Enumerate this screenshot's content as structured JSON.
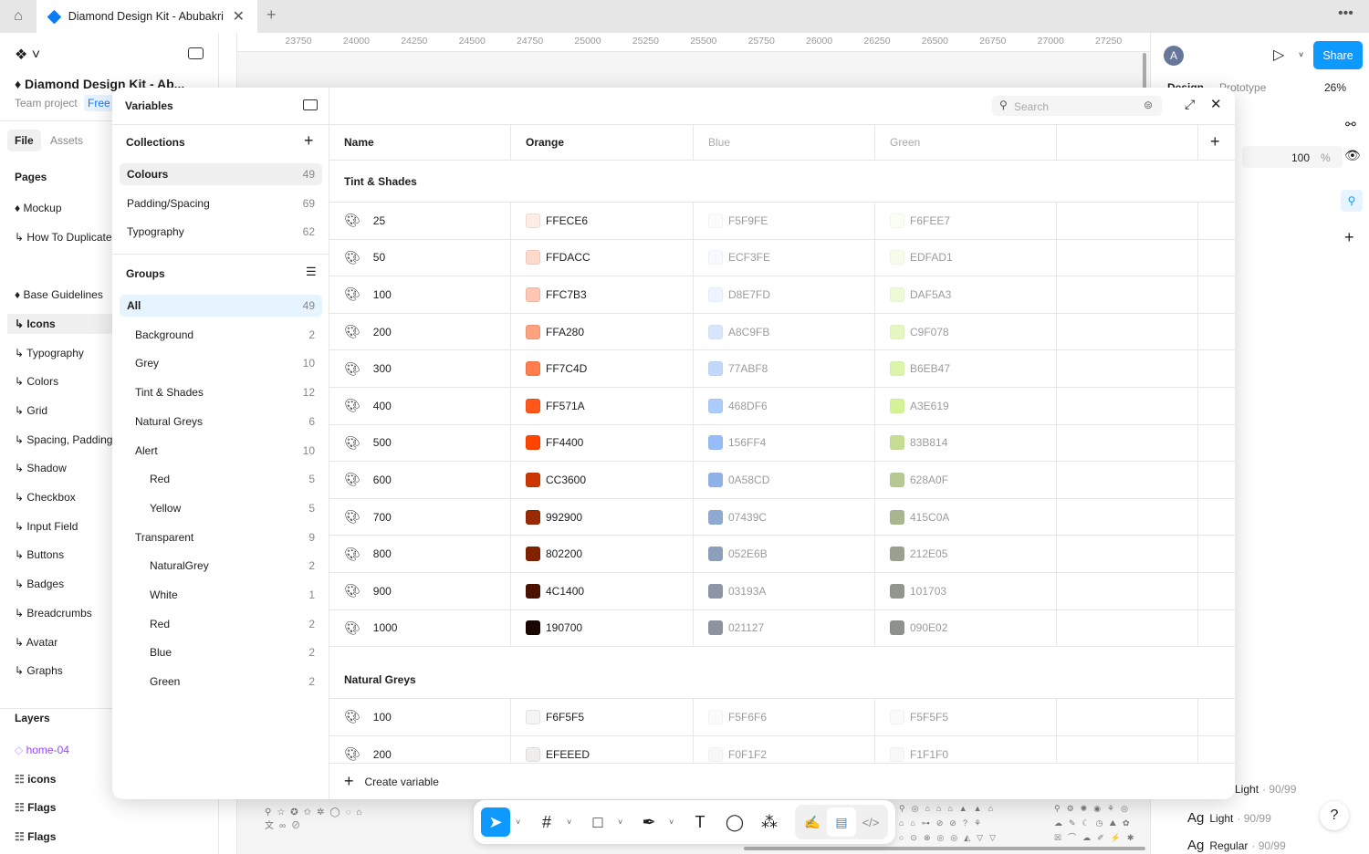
{
  "tabs": {
    "file_tab": "Diamond Design Kit - Abubakriqb"
  },
  "sidebar": {
    "file_name": "Diamond Design Kit - Ab...",
    "project": "Team project",
    "plan": "Free",
    "tab_file": "File",
    "tab_assets": "Assets",
    "pages_title": "Pages",
    "pages": [
      "Mockup",
      "How To Duplicate",
      "",
      "Base Guidelines",
      "Icons",
      "Typography",
      "Colors",
      "Grid",
      "Spacing, Padding",
      "Shadow",
      "Checkbox",
      "Input Field",
      "Buttons",
      "Badges",
      "Breadcrumbs",
      "Avatar",
      "Graphs"
    ],
    "layers_title": "Layers",
    "layers": [
      {
        "label": "home-04",
        "color": "#9747ff"
      },
      {
        "label": "icons"
      },
      {
        "label": "Flags"
      },
      {
        "label": "Flags"
      }
    ]
  },
  "ruler": [
    "23750",
    "24000",
    "24250",
    "24500",
    "24750",
    "25000",
    "25250",
    "25500",
    "25750",
    "26000",
    "26250",
    "26500",
    "26750",
    "27000",
    "27250"
  ],
  "right_panel": {
    "avatar": "A",
    "share": "Share",
    "tab_design": "Design",
    "tab_prototype": "Prototype",
    "zoom": "26%",
    "opacity": "100",
    "percent": "%",
    "type_samples": [
      {
        "ag": "",
        "label": "Light",
        "meta": "· 90/99"
      },
      {
        "ag": "Ag",
        "label": "Light",
        "meta": "· 90/99"
      },
      {
        "ag": "Ag",
        "label": "Regular",
        "meta": "· 90/99"
      }
    ],
    "help": "?"
  },
  "variables": {
    "title": "Variables",
    "collections_title": "Collections",
    "collections": [
      {
        "label": "Colours",
        "count": "49",
        "selected": true
      },
      {
        "label": "Padding/Spacing",
        "count": "69"
      },
      {
        "label": "Typography",
        "count": "62"
      }
    ],
    "groups_title": "Groups",
    "groups": [
      {
        "label": "All",
        "count": "49",
        "level": 0,
        "selected": true
      },
      {
        "label": "Background",
        "count": "2",
        "level": 1
      },
      {
        "label": "Grey",
        "count": "10",
        "level": 1
      },
      {
        "label": "Tint & Shades",
        "count": "12",
        "level": 1
      },
      {
        "label": "Natural Greys",
        "count": "6",
        "level": 1
      },
      {
        "label": "Alert",
        "count": "10",
        "level": 1
      },
      {
        "label": "Red",
        "count": "5",
        "level": 2
      },
      {
        "label": "Yellow",
        "count": "5",
        "level": 2
      },
      {
        "label": "Transparent",
        "count": "9",
        "level": 1
      },
      {
        "label": "NaturalGrey",
        "count": "2",
        "level": 2
      },
      {
        "label": "White",
        "count": "1",
        "level": 2
      },
      {
        "label": "Red",
        "count": "2",
        "level": 2
      },
      {
        "label": "Blue",
        "count": "2",
        "level": 2
      },
      {
        "label": "Green",
        "count": "2",
        "level": 2
      }
    ],
    "search_placeholder": "Search",
    "columns": [
      "Name",
      "Orange",
      "Blue",
      "Green"
    ],
    "sections": [
      {
        "title": "Tint & Shades",
        "rows": [
          [
            "25",
            "FFECE6",
            "F5F9FE",
            "F6FEE7"
          ],
          [
            "50",
            "FFDACC",
            "ECF3FE",
            "EDFAD1"
          ],
          [
            "100",
            "FFC7B3",
            "D8E7FD",
            "DAF5A3"
          ],
          [
            "200",
            "FFA280",
            "A8C9FB",
            "C9F078"
          ],
          [
            "300",
            "FF7C4D",
            "77ABF8",
            "B6EB47"
          ],
          [
            "400",
            "FF571A",
            "468DF6",
            "A3E619"
          ],
          [
            "500",
            "FF4400",
            "156FF4",
            "83B814"
          ],
          [
            "600",
            "CC3600",
            "0A58CD",
            "628A0F"
          ],
          [
            "700",
            "992900",
            "07439C",
            "415C0A"
          ],
          [
            "800",
            "802200",
            "052E6B",
            "212E05"
          ],
          [
            "900",
            "4C1400",
            "03193A",
            "101703"
          ],
          [
            "1000",
            "190700",
            "021127",
            "090E02"
          ]
        ]
      },
      {
        "title": "Natural Greys",
        "rows": [
          [
            "100",
            "F6F5F5",
            "F5F6F6",
            "F5F5F5"
          ],
          [
            "200",
            "EFEEED",
            "F0F1F2",
            "F1F1F0"
          ]
        ]
      }
    ],
    "create_label": "Create variable"
  }
}
